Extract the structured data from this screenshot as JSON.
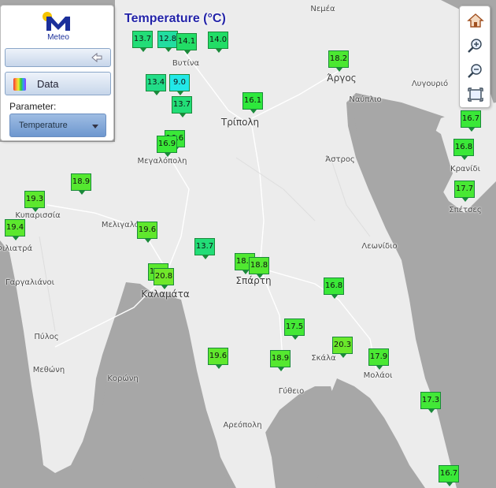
{
  "map": {
    "title": "Temperature (°C)",
    "places": [
      {
        "name": "Νεμέα",
        "big": false
      },
      {
        "name": "Βυτίνα",
        "big": false
      },
      {
        "name": "Άργος",
        "big": true
      },
      {
        "name": "Λυγουριό",
        "big": false
      },
      {
        "name": "Ναύπλιο",
        "big": false
      },
      {
        "name": "Τρίπολη",
        "big": true
      },
      {
        "name": "Μεγαλόπολη",
        "big": false
      },
      {
        "name": "Άστρος",
        "big": false
      },
      {
        "name": "Κρανίδι",
        "big": false
      },
      {
        "name": "Σπέτσες",
        "big": false
      },
      {
        "name": "Κυπαρισσία",
        "big": false
      },
      {
        "name": "Μελιγαλάς",
        "big": false
      },
      {
        "name": "Φιλιατρά",
        "big": false
      },
      {
        "name": "Λεωνίδιο",
        "big": false
      },
      {
        "name": "Γαργαλιάνοι",
        "big": false
      },
      {
        "name": "Σπάρτη",
        "big": true
      },
      {
        "name": "Καλαμάτα",
        "big": true
      },
      {
        "name": "Πύλος",
        "big": false
      },
      {
        "name": "Μεθώνη",
        "big": false
      },
      {
        "name": "Κορώνη",
        "big": false
      },
      {
        "name": "Σκάλα",
        "big": false
      },
      {
        "name": "Μολάοι",
        "big": false
      },
      {
        "name": "Γύθειο",
        "big": false
      },
      {
        "name": "Αρεόπολη",
        "big": false
      }
    ],
    "stations": [
      {
        "value": "13.7",
        "color": "#22dd77"
      },
      {
        "value": "12.8",
        "color": "#22dda0"
      },
      {
        "value": "14.1",
        "color": "#22dd66"
      },
      {
        "value": "14.0",
        "color": "#22dd66"
      },
      {
        "value": "18.2",
        "color": "#4ce832"
      },
      {
        "value": "13.4",
        "color": "#22dd88"
      },
      {
        "value": "9.0",
        "color": "#22e8e8"
      },
      {
        "value": "13.7",
        "color": "#22dd77"
      },
      {
        "value": "16.1",
        "color": "#2ee83c"
      },
      {
        "value": "16.7",
        "color": "#3ae838"
      },
      {
        "value": "16.6",
        "color": "#3ae838"
      },
      {
        "value": "16.9",
        "color": "#3ae838"
      },
      {
        "value": "16.8",
        "color": "#3ae838"
      },
      {
        "value": "18.9",
        "color": "#55e830"
      },
      {
        "value": "17.7",
        "color": "#48e834"
      },
      {
        "value": "19.3",
        "color": "#5ce82e"
      },
      {
        "value": "19.4",
        "color": "#5ce82e"
      },
      {
        "value": "19.6",
        "color": "#60e82d"
      },
      {
        "value": "13.7",
        "color": "#22dd77"
      },
      {
        "value": "18.5",
        "color": "#50e831"
      },
      {
        "value": "18.8",
        "color": "#54e830"
      },
      {
        "value": "19.4",
        "color": "#5ce82e"
      },
      {
        "value": "20.8",
        "color": "#70e82a"
      },
      {
        "value": "16.8",
        "color": "#3ae838"
      },
      {
        "value": "17.5",
        "color": "#44e836"
      },
      {
        "value": "20.3",
        "color": "#6ae82b"
      },
      {
        "value": "17.9",
        "color": "#4ae833"
      },
      {
        "value": "19.6",
        "color": "#60e82d"
      },
      {
        "value": "18.9",
        "color": "#55e830"
      },
      {
        "value": "17.3",
        "color": "#42e837"
      },
      {
        "value": "16.7",
        "color": "#3ae838"
      }
    ]
  },
  "panel": {
    "logo_text": "Meteo",
    "data_button_label": "Data",
    "parameter_label": "Parameter:",
    "parameter_value": "Temperature"
  },
  "toolbar": {
    "home": "home-icon",
    "zoom_in": "zoom-in-icon",
    "zoom_out": "zoom-out-icon",
    "extent": "full-extent-icon"
  }
}
